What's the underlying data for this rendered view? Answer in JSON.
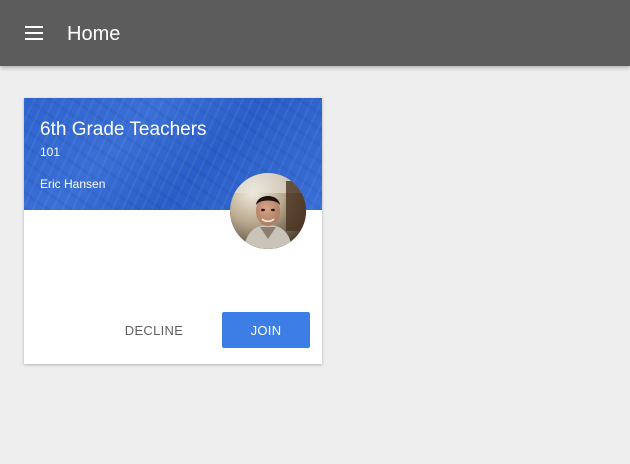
{
  "app_bar": {
    "title": "Home",
    "menu_icon": "menu-icon"
  },
  "card": {
    "class_name": "6th Grade Teachers",
    "section": "101",
    "teacher": "Eric Hansen",
    "avatar_icon": "teacher-avatar",
    "header_color": "#2f64cf",
    "actions": {
      "decline_label": "DECLINE",
      "join_label": "JOIN"
    },
    "join_color": "#3d7de6"
  },
  "colors": {
    "app_bar": "#5c5c5c",
    "background": "#eeeeee"
  }
}
